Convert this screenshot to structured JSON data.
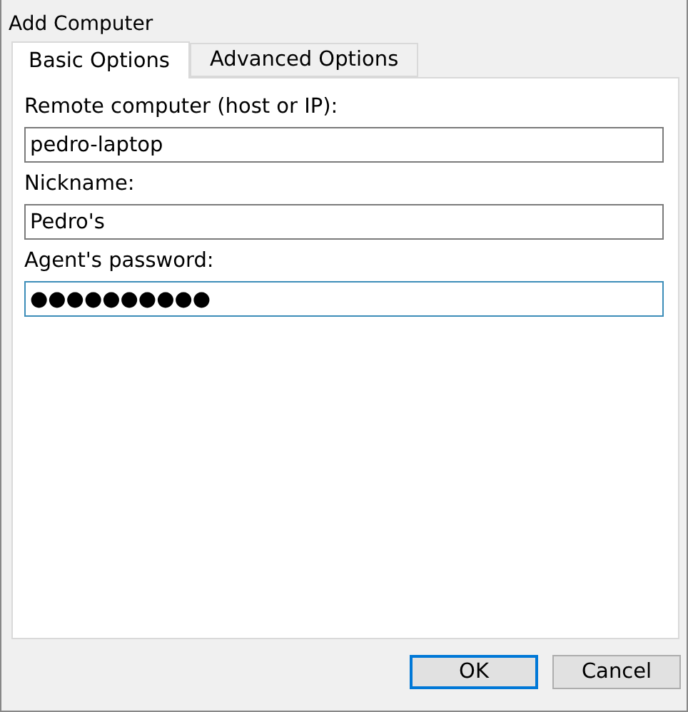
{
  "window": {
    "title": "Add Computer"
  },
  "tabs": [
    {
      "label": "Basic Options",
      "selected": true
    },
    {
      "label": "Advanced Options",
      "selected": false
    }
  ],
  "fields": [
    {
      "label": "Remote computer (host or IP):",
      "value": "pedro-laptop",
      "focused": false
    },
    {
      "label": "Nickname:",
      "value": "Pedro's",
      "focused": false
    },
    {
      "label": "Agent's password:",
      "value": "●●●●●●●●●●",
      "focused": true
    }
  ],
  "buttons": [
    {
      "label": "OK",
      "default": true
    },
    {
      "label": "Cancel",
      "default": false
    }
  ]
}
